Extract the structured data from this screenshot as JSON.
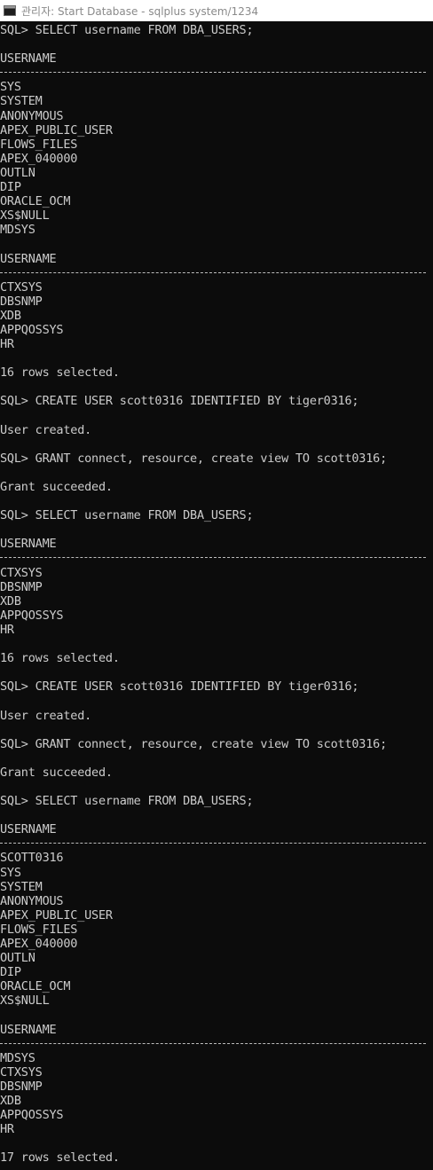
{
  "window": {
    "title": "관리자: Start Database - sqlplus  system/1234"
  },
  "console": {
    "lines": [
      {
        "t": "text",
        "v": "SQL> SELECT username FROM DBA_USERS;"
      },
      {
        "t": "blank"
      },
      {
        "t": "text",
        "v": "USERNAME"
      },
      {
        "t": "rule"
      },
      {
        "t": "text",
        "v": "SYS"
      },
      {
        "t": "text",
        "v": "SYSTEM"
      },
      {
        "t": "text",
        "v": "ANONYMOUS"
      },
      {
        "t": "text",
        "v": "APEX_PUBLIC_USER"
      },
      {
        "t": "text",
        "v": "FLOWS_FILES"
      },
      {
        "t": "text",
        "v": "APEX_040000"
      },
      {
        "t": "text",
        "v": "OUTLN"
      },
      {
        "t": "text",
        "v": "DIP"
      },
      {
        "t": "text",
        "v": "ORACLE_OCM"
      },
      {
        "t": "text",
        "v": "XS$NULL"
      },
      {
        "t": "text",
        "v": "MDSYS"
      },
      {
        "t": "blank"
      },
      {
        "t": "text",
        "v": "USERNAME"
      },
      {
        "t": "rule"
      },
      {
        "t": "text",
        "v": "CTXSYS"
      },
      {
        "t": "text",
        "v": "DBSNMP"
      },
      {
        "t": "text",
        "v": "XDB"
      },
      {
        "t": "text",
        "v": "APPQOSSYS"
      },
      {
        "t": "text",
        "v": "HR"
      },
      {
        "t": "blank"
      },
      {
        "t": "text",
        "v": "16 rows selected."
      },
      {
        "t": "blank"
      },
      {
        "t": "text",
        "v": "SQL> CREATE USER scott0316 IDENTIFIED BY tiger0316;"
      },
      {
        "t": "blank"
      },
      {
        "t": "text",
        "v": "User created."
      },
      {
        "t": "blank"
      },
      {
        "t": "text",
        "v": "SQL> GRANT connect, resource, create view TO scott0316;"
      },
      {
        "t": "blank"
      },
      {
        "t": "text",
        "v": "Grant succeeded."
      },
      {
        "t": "blank"
      },
      {
        "t": "text",
        "v": "SQL> SELECT username FROM DBA_USERS;"
      },
      {
        "t": "blank"
      },
      {
        "t": "text",
        "v": "USERNAME"
      },
      {
        "t": "rule"
      },
      {
        "t": "text",
        "v": "CTXSYS"
      },
      {
        "t": "text",
        "v": "DBSNMP"
      },
      {
        "t": "text",
        "v": "XDB"
      },
      {
        "t": "text",
        "v": "APPQOSSYS"
      },
      {
        "t": "text",
        "v": "HR"
      },
      {
        "t": "blank"
      },
      {
        "t": "text",
        "v": "16 rows selected."
      },
      {
        "t": "blank"
      },
      {
        "t": "text",
        "v": "SQL> CREATE USER scott0316 IDENTIFIED BY tiger0316;"
      },
      {
        "t": "blank"
      },
      {
        "t": "text",
        "v": "User created."
      },
      {
        "t": "blank"
      },
      {
        "t": "text",
        "v": "SQL> GRANT connect, resource, create view TO scott0316;"
      },
      {
        "t": "blank"
      },
      {
        "t": "text",
        "v": "Grant succeeded."
      },
      {
        "t": "blank"
      },
      {
        "t": "text",
        "v": "SQL> SELECT username FROM DBA_USERS;"
      },
      {
        "t": "blank"
      },
      {
        "t": "text",
        "v": "USERNAME"
      },
      {
        "t": "rule"
      },
      {
        "t": "text",
        "v": "SCOTT0316"
      },
      {
        "t": "text",
        "v": "SYS"
      },
      {
        "t": "text",
        "v": "SYSTEM"
      },
      {
        "t": "text",
        "v": "ANONYMOUS"
      },
      {
        "t": "text",
        "v": "APEX_PUBLIC_USER"
      },
      {
        "t": "text",
        "v": "FLOWS_FILES"
      },
      {
        "t": "text",
        "v": "APEX_040000"
      },
      {
        "t": "text",
        "v": "OUTLN"
      },
      {
        "t": "text",
        "v": "DIP"
      },
      {
        "t": "text",
        "v": "ORACLE_OCM"
      },
      {
        "t": "text",
        "v": "XS$NULL"
      },
      {
        "t": "blank"
      },
      {
        "t": "text",
        "v": "USERNAME"
      },
      {
        "t": "rule"
      },
      {
        "t": "text",
        "v": "MDSYS"
      },
      {
        "t": "text",
        "v": "CTXSYS"
      },
      {
        "t": "text",
        "v": "DBSNMP"
      },
      {
        "t": "text",
        "v": "XDB"
      },
      {
        "t": "text",
        "v": "APPQOSSYS"
      },
      {
        "t": "text",
        "v": "HR"
      },
      {
        "t": "blank"
      },
      {
        "t": "text",
        "v": "17 rows selected."
      }
    ]
  }
}
